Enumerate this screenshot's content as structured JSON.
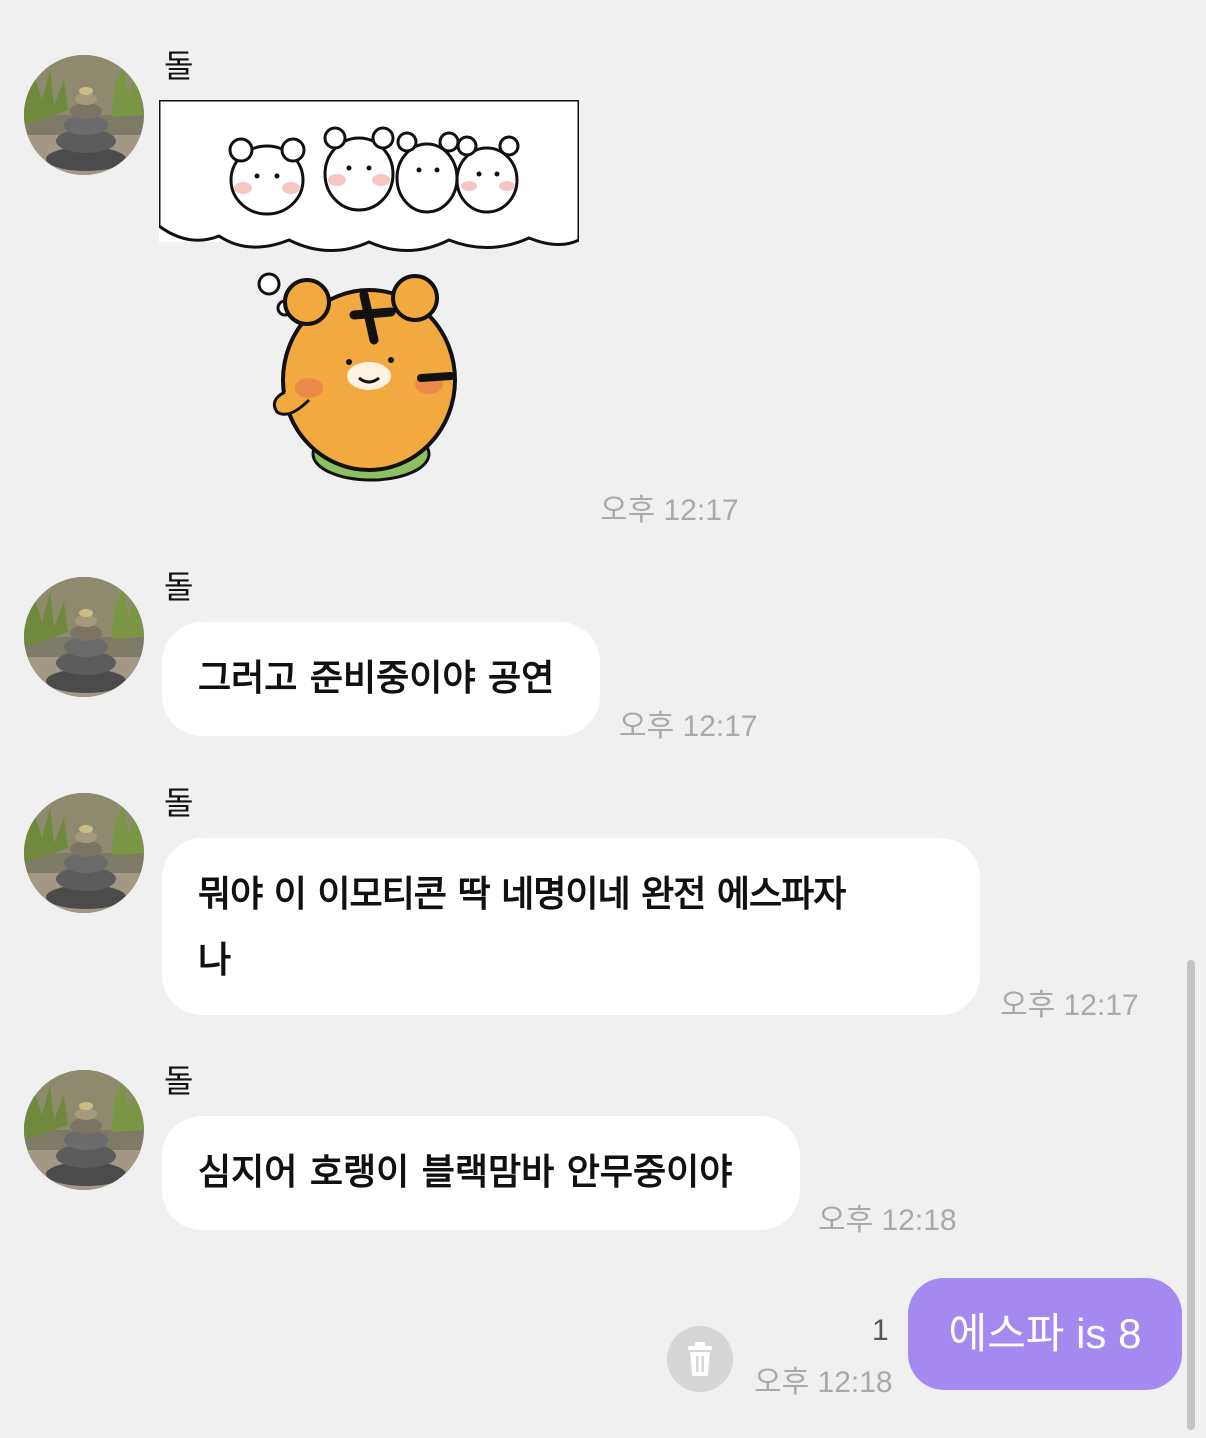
{
  "messages": [
    {
      "sender": "돌",
      "type": "sticker",
      "time": "오후 12:17"
    },
    {
      "sender": "돌",
      "type": "text",
      "text": "그러고 준비중이야 공연",
      "time": "오후 12:17"
    },
    {
      "sender": "돌",
      "type": "text",
      "text_line1": "뭐야 이 이모티콘 딱 네명이네 완전 에스파자",
      "text_line2": "나",
      "time": "오후 12:17"
    },
    {
      "sender": "돌",
      "type": "text",
      "text": "심지어 호랭이 블랙맘바 안무중이야",
      "time": "오후 12:18"
    }
  ],
  "my_message": {
    "text": "에스파 is 8",
    "time": "오후 12:18",
    "unread_count": "1"
  },
  "icons": {
    "avatar": "stacked-stones-photo",
    "delete": "trash-icon"
  },
  "colors": {
    "background": "#f0f0f0",
    "incoming_bubble": "#ffffff",
    "outgoing_bubble": "#a48af0",
    "timestamp": "#a9a9a9"
  }
}
